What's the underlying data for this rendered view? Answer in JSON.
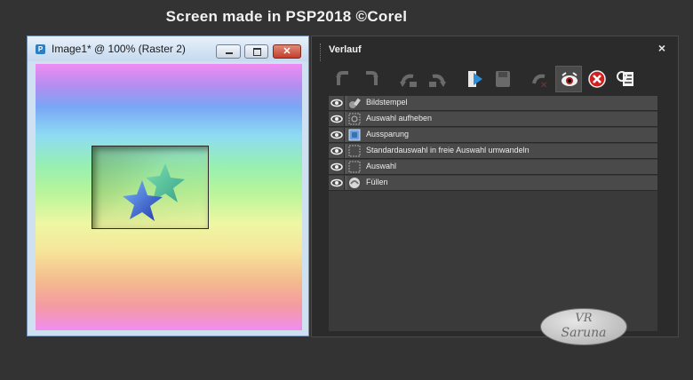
{
  "caption": "Screen made in PSP2018 ©Corel",
  "image_window": {
    "title": "Image1* @ 100% (Raster 2)",
    "app_icon": "psp-icon",
    "buttons": [
      "minimize",
      "maximize",
      "close"
    ]
  },
  "history_panel": {
    "title": "Verlauf",
    "close_glyph": "×",
    "toolbar": [
      {
        "icon": "undo-icon",
        "enabled": false
      },
      {
        "icon": "redo-icon",
        "enabled": false
      },
      {
        "icon": "undo-selected-icon",
        "enabled": false
      },
      {
        "icon": "redo-selected-icon",
        "enabled": false
      },
      {
        "icon": "quickscript-icon",
        "enabled": true
      },
      {
        "icon": "save-script-icon",
        "enabled": false
      },
      {
        "icon": "clear-history-icon",
        "enabled": false
      },
      {
        "icon": "toggle-visibility-icon",
        "enabled": true
      },
      {
        "icon": "delete-history-icon",
        "enabled": true
      },
      {
        "icon": "history-properties-icon",
        "enabled": true
      }
    ],
    "items": [
      {
        "label": "Bildstempel",
        "icon": "stamp-icon"
      },
      {
        "label": "Auswahl aufheben",
        "icon": "select-none-icon"
      },
      {
        "label": "Aussparung",
        "icon": "cutout-icon"
      },
      {
        "label": "Standardauswahl in freie Auswahl umwandeln",
        "icon": "selection-icon"
      },
      {
        "label": "Auswahl",
        "icon": "selection-icon"
      },
      {
        "label": "Füllen",
        "icon": "fill-icon"
      }
    ]
  },
  "watermark": {
    "line1": "VR",
    "line2": "Saruna"
  }
}
